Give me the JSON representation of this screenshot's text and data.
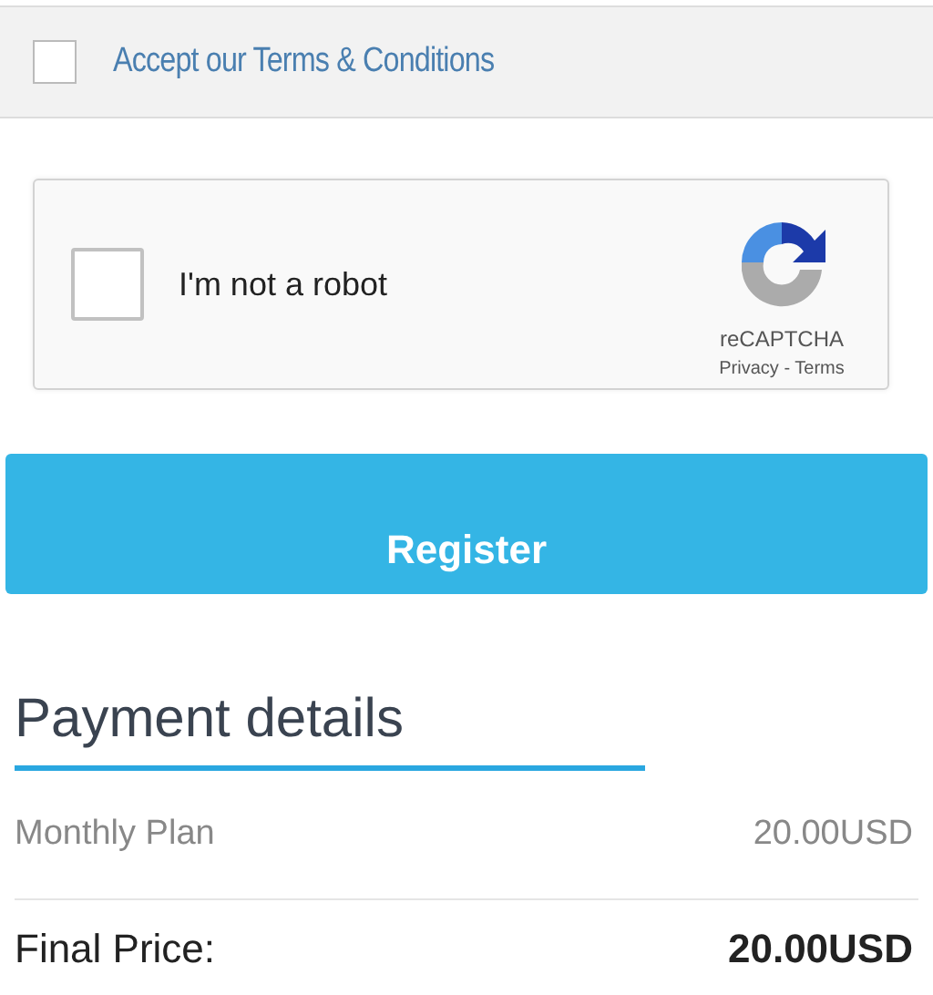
{
  "terms": {
    "label": "Accept our Terms & Conditions",
    "checked": false
  },
  "captcha": {
    "label": "I'm not a robot",
    "checked": false,
    "brand": "reCAPTCHA",
    "links": "Privacy - Terms"
  },
  "register_button": "Register",
  "payment": {
    "title": "Payment details",
    "rows": [
      {
        "kind": "item",
        "label": "Monthly Plan",
        "value": "20.00USD"
      },
      {
        "kind": "total",
        "label": "Final Price:",
        "value": "20.00USD"
      }
    ]
  }
}
